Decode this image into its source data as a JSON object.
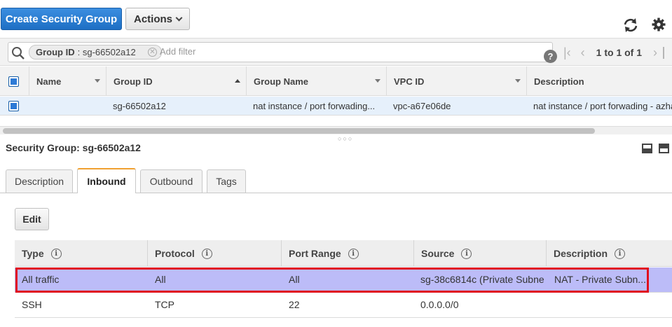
{
  "toolbar": {
    "create_label": "Create Security Group",
    "actions_label": "Actions"
  },
  "filter": {
    "token_key": "Group ID",
    "token_value": ": sg-66502a12",
    "placeholder": "Add filter",
    "help": "?"
  },
  "pager": {
    "label": "1 to 1 of 1"
  },
  "grid": {
    "columns": [
      "Name",
      "Group ID",
      "Group Name",
      "VPC ID",
      "Description"
    ],
    "rows": [
      {
        "name": "",
        "group_id": "sg-66502a12",
        "group_name": "nat instance / port forwading...",
        "vpc_id": "vpc-a67e06de",
        "description": "nat instance / port forwading - azha"
      }
    ]
  },
  "detail": {
    "title": "Security Group: sg-66502a12",
    "tabs": [
      "Description",
      "Inbound",
      "Outbound",
      "Tags"
    ],
    "active_tab": "Inbound",
    "edit_label": "Edit",
    "rule_columns": [
      "Type",
      "Protocol",
      "Port Range",
      "Source",
      "Description"
    ],
    "rules": [
      {
        "type": "All traffic",
        "protocol": "All",
        "port_range": "All",
        "source": "sg-38c6814c (Private Subne",
        "description": "NAT - Private Subn..."
      },
      {
        "type": "SSH",
        "protocol": "TCP",
        "port_range": "22",
        "source": "0.0.0.0/0",
        "description": ""
      }
    ]
  },
  "colors": {
    "primary_button": "#1e6fc4",
    "active_tab_accent": "#f0a030",
    "highlight_row": "#bcbcf8",
    "highlight_border": "#e0101e"
  }
}
